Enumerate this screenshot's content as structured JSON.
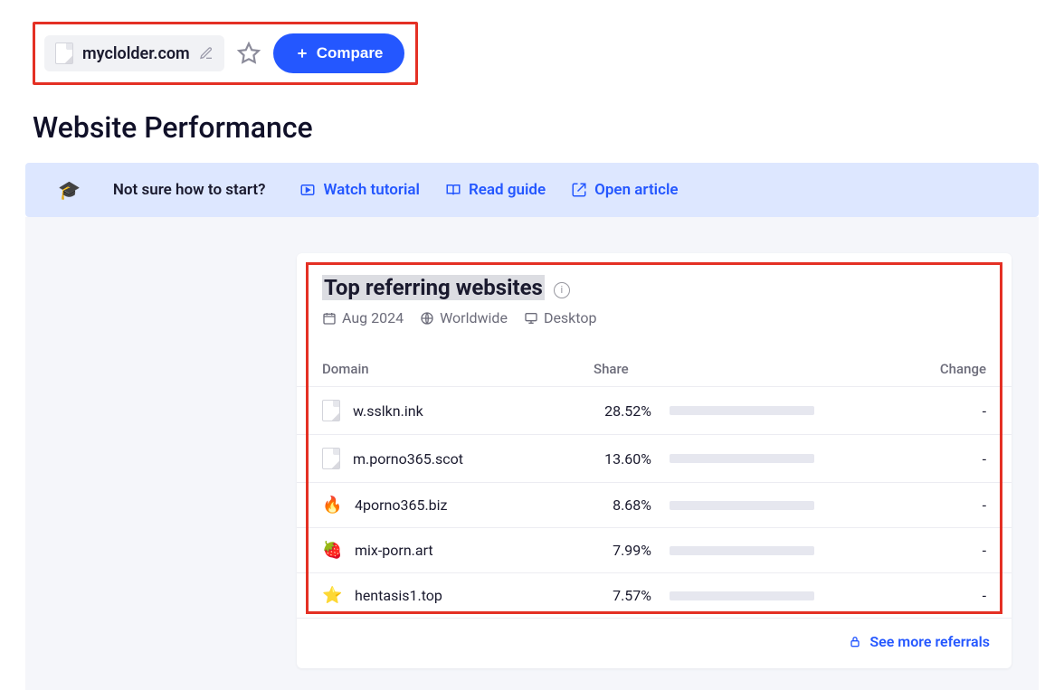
{
  "header": {
    "domain": "myclolder.com",
    "compare_label": "Compare"
  },
  "page_title": "Website Performance",
  "help": {
    "prompt": "Not sure how to start?",
    "watch": "Watch tutorial",
    "read": "Read guide",
    "open": "Open article"
  },
  "card": {
    "title": "Top referring websites",
    "date": "Aug 2024",
    "region": "Worldwide",
    "device": "Desktop",
    "columns": {
      "domain": "Domain",
      "share": "Share",
      "change": "Change"
    },
    "rows": [
      {
        "icon": "doc",
        "domain": "w.sslkn.ink",
        "share": "28.52%",
        "share_pct": 28.52,
        "change": "-"
      },
      {
        "icon": "doc",
        "domain": "m.porno365.scot",
        "share": "13.60%",
        "share_pct": 13.6,
        "change": "-"
      },
      {
        "icon": "flames",
        "domain": "4porno365.biz",
        "share": "8.68%",
        "share_pct": 8.68,
        "change": "-"
      },
      {
        "icon": "berry",
        "domain": "mix-porn.art",
        "share": "7.99%",
        "share_pct": 7.99,
        "change": "-"
      },
      {
        "icon": "star",
        "domain": "hentasis1.top",
        "share": "7.57%",
        "share_pct": 7.57,
        "change": "-"
      }
    ],
    "see_more": "See more referrals"
  },
  "chart_data": {
    "type": "bar",
    "title": "Top referring websites — Share",
    "xlabel": "Domain",
    "ylabel": "Share (%)",
    "ylim": [
      0,
      30
    ],
    "categories": [
      "w.sslkn.ink",
      "m.porno365.scot",
      "4porno365.biz",
      "mix-porn.art",
      "hentasis1.top"
    ],
    "values": [
      28.52,
      13.6,
      8.68,
      7.99,
      7.57
    ]
  }
}
